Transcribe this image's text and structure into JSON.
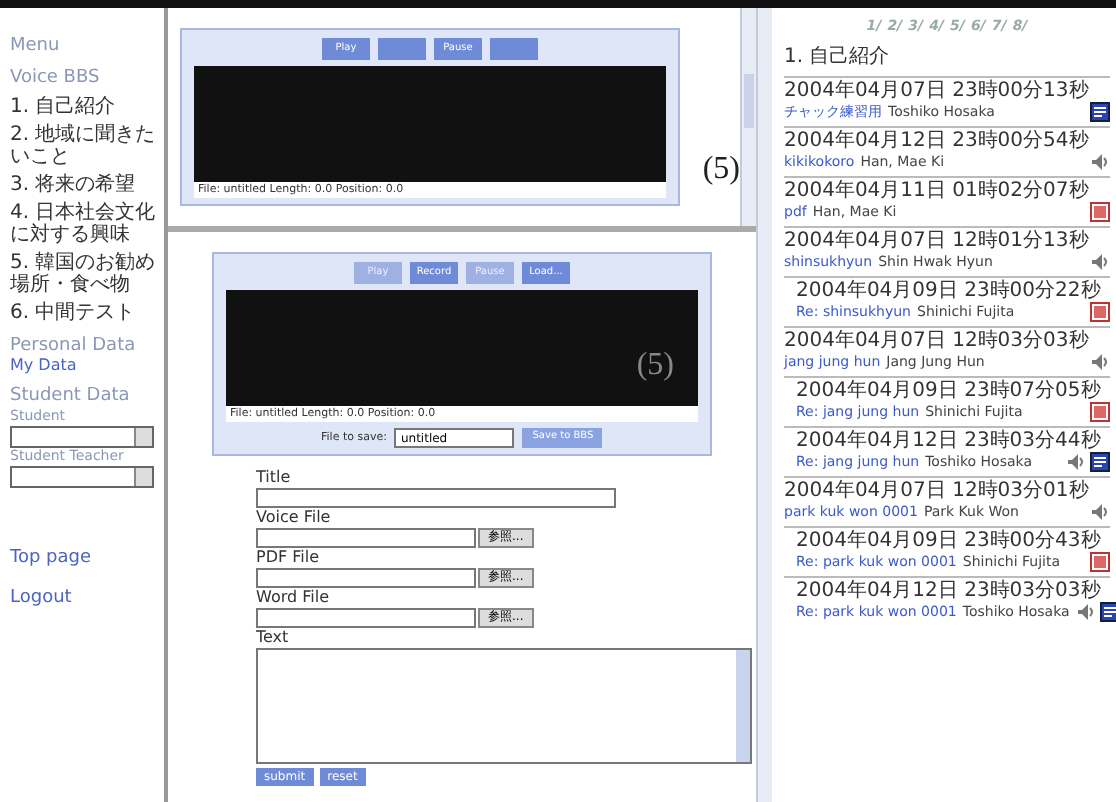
{
  "sidebar": {
    "heading": "Menu",
    "bbs_title": "Voice BBS",
    "topics": [
      "1. 自己紹介",
      "2. 地域に聞きたいこと",
      "3. 将来の希望",
      "4. 日本社会文化に対する興味",
      "5. 韓国のお勧め場所・食べ物",
      "6. 中間テスト"
    ],
    "personal_title": "Personal Data",
    "personal_link": "My Data",
    "student_title": "Student Data",
    "student_label": "Student",
    "teacher_label": "Student Teacher",
    "links": [
      "Top page",
      "Logout"
    ]
  },
  "players": [
    {
      "buttons": [
        {
          "kind": "text",
          "label": "Play",
          "disabled": false
        },
        {
          "kind": "blank",
          "disabled": false
        },
        {
          "kind": "text",
          "label": "Pause",
          "disabled": false
        },
        {
          "kind": "blank",
          "disabled": false
        }
      ],
      "status": "File: untitled  Length: 0.0  Position: 0.0",
      "annotation": "(5)"
    },
    {
      "buttons": [
        {
          "kind": "text",
          "label": "Play",
          "disabled": true
        },
        {
          "kind": "text",
          "label": "Record",
          "disabled": false
        },
        {
          "kind": "text",
          "label": "Pause",
          "disabled": true
        },
        {
          "kind": "text",
          "label": "Load...",
          "disabled": false
        }
      ],
      "status": "File: untitled  Length: 0.0  Position: 0.0",
      "annotation": "(5)",
      "save": {
        "label": "File to save:",
        "value": "untitled",
        "button": "Save to BBS"
      }
    }
  ],
  "form": {
    "fields": [
      {
        "kind": "text",
        "label": "Title"
      },
      {
        "kind": "file",
        "label": "Voice File",
        "browse": "参照..."
      },
      {
        "kind": "file",
        "label": "PDF File",
        "browse": "参照..."
      },
      {
        "kind": "file",
        "label": "Word File",
        "browse": "参照..."
      },
      {
        "kind": "textarea",
        "label": "Text"
      }
    ],
    "buttons": [
      "submit",
      "reset"
    ]
  },
  "bbs": {
    "pages": [
      "1/",
      "2/",
      "3/",
      "4/",
      "5/",
      "6/",
      "7/",
      "8/"
    ],
    "topic": "1. 自己紹介",
    "posts": [
      {
        "date": "2004年04月07日 23時00分13秒",
        "title": "チャック練習用",
        "author": "Toshiko Hosaka",
        "attachments": [
          {
            "kind": "word"
          }
        ]
      },
      {
        "date": "2004年04月12日 23時00分54秒",
        "title": "kikikokoro",
        "author": "Han, Mae Ki",
        "attachments": [
          {
            "kind": "voice"
          }
        ]
      },
      {
        "date": "2004年04月11日 01時02分07秒",
        "title": "pdf",
        "author": "Han, Mae Ki",
        "attachments": [
          {
            "kind": "pdf"
          }
        ]
      },
      {
        "date": "2004年04月07日 12時01分13秒",
        "title": "shinsukhyun",
        "author": "Shin Hwak Hyun",
        "attachments": [
          {
            "kind": "voice"
          }
        ],
        "replies": [
          {
            "date": "2004年04月09日 23時00分22秒",
            "title": "Re: shinsukhyun",
            "author": "Shinichi Fujita",
            "attachments": [
              {
                "kind": "pdf"
              }
            ]
          }
        ]
      },
      {
        "date": "2004年04月07日 12時03分03秒",
        "title": "jang jung hun",
        "author": "Jang Jung Hun",
        "attachments": [
          {
            "kind": "voice"
          }
        ],
        "replies": [
          {
            "date": "2004年04月09日 23時07分05秒",
            "title": "Re: jang jung hun",
            "author": "Shinichi Fujita",
            "attachments": [
              {
                "kind": "pdf"
              }
            ]
          },
          {
            "date": "2004年04月12日 23時03分44秒",
            "title": "Re: jang jung hun",
            "author": "Toshiko Hosaka",
            "attachments": [
              {
                "kind": "voice"
              },
              {
                "kind": "word"
              }
            ]
          }
        ]
      },
      {
        "date": "2004年04月07日 12時03分01秒",
        "title": "park kuk won 0001",
        "author": "Park Kuk Won",
        "attachments": [
          {
            "kind": "voice"
          }
        ],
        "replies": [
          {
            "date": "2004年04月09日 23時00分43秒",
            "title": "Re: park kuk won 0001",
            "author": "Shinichi Fujita",
            "attachments": [
              {
                "kind": "pdf"
              }
            ]
          },
          {
            "date": "2004年04月12日 23時03分03秒",
            "title": "Re: park kuk won 0001",
            "author": "Toshiko Hosaka",
            "attachments": [
              {
                "kind": "voice"
              },
              {
                "kind": "word"
              }
            ]
          }
        ]
      }
    ]
  }
}
